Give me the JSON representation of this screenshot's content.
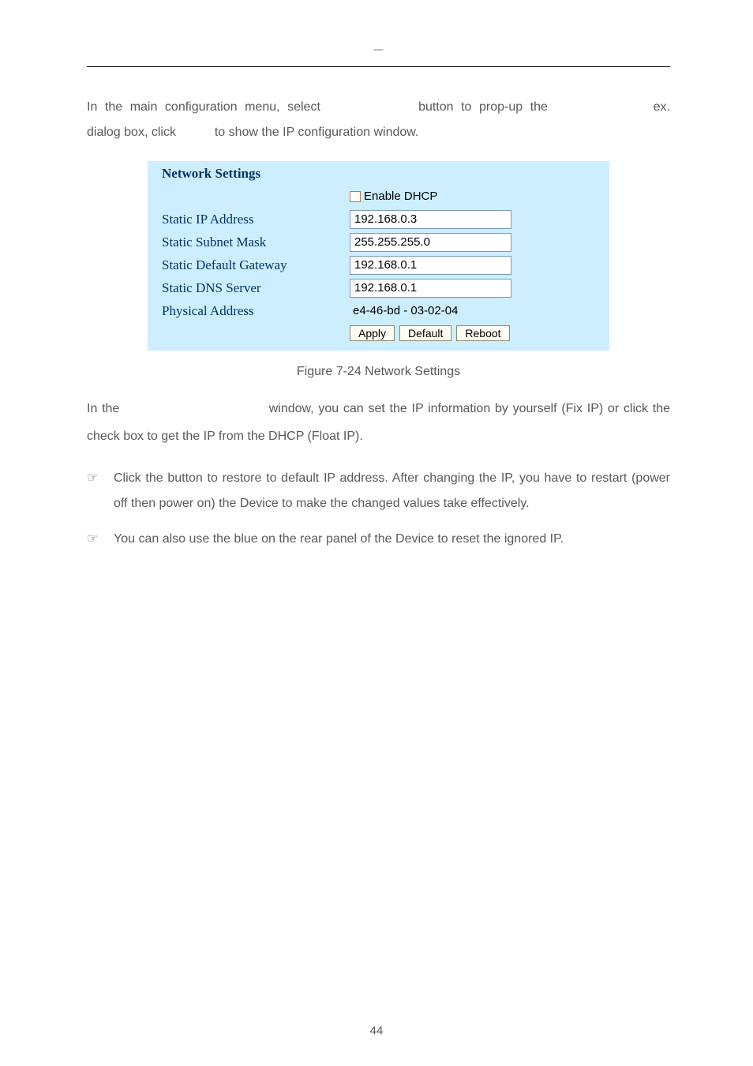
{
  "header": {
    "dash": "—"
  },
  "intro": {
    "text": "In the main configuration menu, select             button to prop-up the              ex.                                                    dialog box, click           to show the IP configuration window."
  },
  "panel": {
    "title": "Network Settings",
    "dhcp_row": {
      "checkbox_label": "Enable DHCP"
    },
    "rows": [
      {
        "label": "Static IP Address",
        "value": "192.168.0.3"
      },
      {
        "label": "Static Subnet Mask",
        "value": "255.255.255.0"
      },
      {
        "label": "Static Default Gateway",
        "value": "192.168.0.1"
      },
      {
        "label": "Static DNS Server",
        "value": "192.168.0.1"
      }
    ],
    "physical_label": "Physical Address",
    "physical_value": "e4-46-bd - 03-02-04",
    "buttons": {
      "apply": "Apply",
      "default": "Default",
      "reboot": "Reboot"
    }
  },
  "figure_caption": "Figure 7-24 Network Settings",
  "para2": "In the                                 window, you can set the IP information by yourself (Fix IP) or click the                        check box to get the IP from the DHCP (Float IP).",
  "bullets": [
    "Click the              button to restore to default IP address. After changing the IP, you have to restart (power off then power on) the Device to make the changed values take effectively.",
    "You can also use the blue                  on the rear panel of the Device to reset the ignored IP."
  ],
  "bullet_sym": "☞",
  "page_number": "44"
}
